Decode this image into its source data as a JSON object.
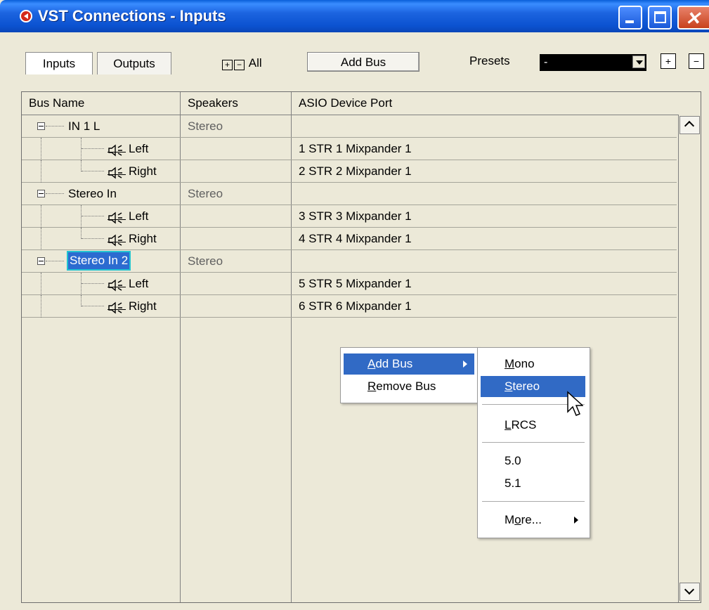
{
  "window": {
    "title": "VST Connections - Inputs",
    "controls": {
      "minimize": "minimize",
      "maximize": "maximize",
      "close": "✕"
    }
  },
  "toolbar": {
    "tabs": [
      {
        "label": "Inputs",
        "active": true
      },
      {
        "label": "Outputs",
        "active": false
      }
    ],
    "expand_all_label": "All",
    "add_bus_label": "Add Bus",
    "presets_label": "Presets",
    "presets_value": "-"
  },
  "table": {
    "columns": [
      "Bus Name",
      "Speakers",
      "ASIO Device Port"
    ],
    "rows": [
      {
        "type": "bus",
        "name": "IN 1 L",
        "speakers": "Stereo",
        "port": "",
        "selected": false
      },
      {
        "type": "channel",
        "name": "Left",
        "speakers": "",
        "port": "1 STR 1  Mixpander 1"
      },
      {
        "type": "channel",
        "name": "Right",
        "speakers": "",
        "port": "2 STR 2  Mixpander 1"
      },
      {
        "type": "bus",
        "name": "Stereo In",
        "speakers": "Stereo",
        "port": "",
        "selected": false
      },
      {
        "type": "channel",
        "name": "Left",
        "speakers": "",
        "port": "3 STR 3  Mixpander 1"
      },
      {
        "type": "channel",
        "name": "Right",
        "speakers": "",
        "port": "4 STR 4  Mixpander 1"
      },
      {
        "type": "bus",
        "name": "Stereo In 2",
        "speakers": "Stereo",
        "port": "",
        "selected": true
      },
      {
        "type": "channel",
        "name": "Left",
        "speakers": "",
        "port": "5 STR 5  Mixpander 1"
      },
      {
        "type": "channel",
        "name": "Right",
        "speakers": "",
        "port": "6 STR 6  Mixpander 1"
      }
    ]
  },
  "context_menu": {
    "items": [
      {
        "label_mnemonic": "A",
        "label_rest": "dd Bus",
        "submenu": true,
        "highlighted": true
      },
      {
        "label_mnemonic": "R",
        "label_rest": "emove Bus",
        "submenu": false,
        "highlighted": false
      }
    ]
  },
  "submenu": {
    "items": [
      {
        "label_mnemonic": "M",
        "label_rest": "ono",
        "highlighted": false
      },
      {
        "label_mnemonic": "S",
        "label_rest": "tereo",
        "highlighted": true
      },
      {
        "label_mnemonic": "L",
        "label_rest": "RCS",
        "highlighted": false
      },
      {
        "label_mnemonic": "",
        "label_rest": "5.0",
        "highlighted": false
      },
      {
        "label_mnemonic": "",
        "label_rest": "5.1",
        "highlighted": false
      },
      {
        "label_pre": "M",
        "label_mnemonic": "o",
        "label_rest": "re...",
        "submenu": true,
        "highlighted": false
      }
    ]
  },
  "colors": {
    "titlebar": "#1c64e0",
    "menu_highlight": "#316ac5",
    "selection": "#2c6bd0"
  }
}
